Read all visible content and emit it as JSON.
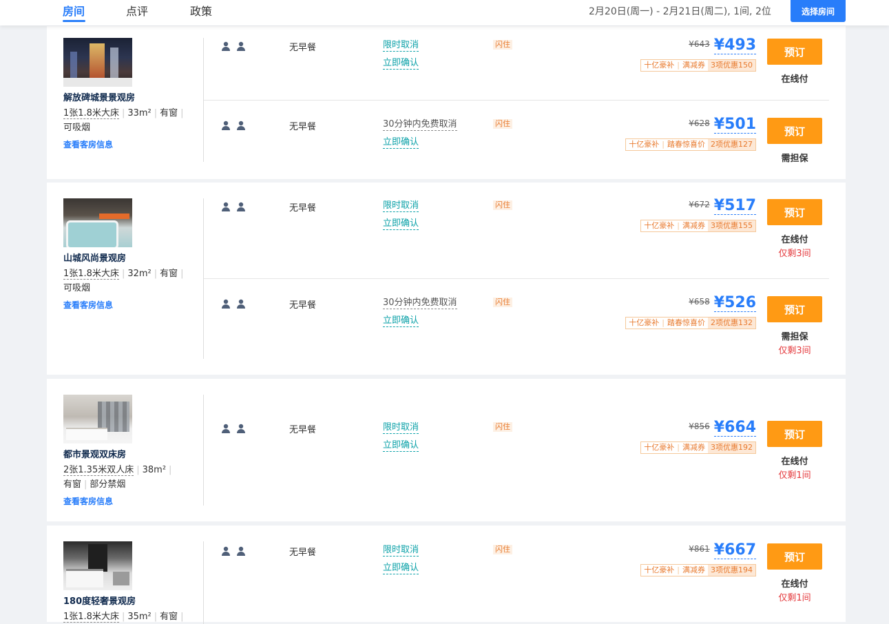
{
  "header": {
    "tabs": [
      "房间",
      "点评",
      "政策"
    ],
    "date_summary": "2月20日(周一) - 2月21日(周二), 1间, 2位",
    "select_button": "选择房间"
  },
  "rooms": [
    {
      "name": "解放碑城景景观房",
      "bed": "1张1.8米大床",
      "area": "33m²",
      "window": "有窗",
      "smoke": "可吸烟",
      "link": "查看客房信息",
      "rates": [
        {
          "meal": "无早餐",
          "cancel": "限时取消",
          "confirm": "立即确认",
          "flash": "闪住",
          "orig": "¥643",
          "price": "¥493",
          "tags": [
            "十亿豪补",
            "满减券",
            "3项优惠150"
          ],
          "book": "预订",
          "pay": "在线付",
          "left": ""
        },
        {
          "meal": "无早餐",
          "cancel": "30分钟内免费取消",
          "confirm": "立即确认",
          "flash": "闪住",
          "orig": "¥628",
          "price": "¥501",
          "tags": [
            "十亿豪补",
            "踏春惊喜价",
            "2项优惠127"
          ],
          "book": "预订",
          "pay": "需担保",
          "left": ""
        }
      ]
    },
    {
      "name": "山城风尚景观房",
      "bed": "1张1.8米大床",
      "area": "32m²",
      "window": "有窗",
      "smoke": "可吸烟",
      "link": "查看客房信息",
      "rates": [
        {
          "meal": "无早餐",
          "cancel": "限时取消",
          "confirm": "立即确认",
          "flash": "闪住",
          "orig": "¥672",
          "price": "¥517",
          "tags": [
            "十亿豪补",
            "满减券",
            "3项优惠155"
          ],
          "book": "预订",
          "pay": "在线付",
          "left": "仅剩3间"
        },
        {
          "meal": "无早餐",
          "cancel": "30分钟内免费取消",
          "confirm": "立即确认",
          "flash": "闪住",
          "orig": "¥658",
          "price": "¥526",
          "tags": [
            "十亿豪补",
            "踏春惊喜价",
            "2项优惠132"
          ],
          "book": "预订",
          "pay": "需担保",
          "left": "仅剩3间"
        }
      ]
    },
    {
      "name": "都市景观双床房",
      "bed": "2张1.35米双人床",
      "area": "38m²",
      "window": "有窗",
      "smoke": "部分禁烟",
      "link": "查看客房信息",
      "rates": [
        {
          "meal": "无早餐",
          "cancel": "限时取消",
          "confirm": "立即确认",
          "flash": "闪住",
          "orig": "¥856",
          "price": "¥664",
          "tags": [
            "十亿豪补",
            "满减券",
            "3项优惠192"
          ],
          "book": "预订",
          "pay": "在线付",
          "left": "仅剩1间"
        }
      ]
    },
    {
      "name": "180度轻奢景观房",
      "bed": "1张1.8米大床",
      "area": "35m²",
      "window": "有窗",
      "smoke": "",
      "link": "",
      "rates": [
        {
          "meal": "无早餐",
          "cancel": "限时取消",
          "confirm": "立即确认",
          "flash": "闪住",
          "orig": "¥861",
          "price": "¥667",
          "tags": [
            "十亿豪补",
            "满减券",
            "3项优惠194"
          ],
          "book": "预订",
          "pay": "在线付",
          "left": "仅剩1间"
        }
      ]
    }
  ],
  "colors": {
    "accent": "#287dfa",
    "book": "#ff9a14",
    "cancel": "#0ba1a8",
    "warn": "#e4393c"
  }
}
